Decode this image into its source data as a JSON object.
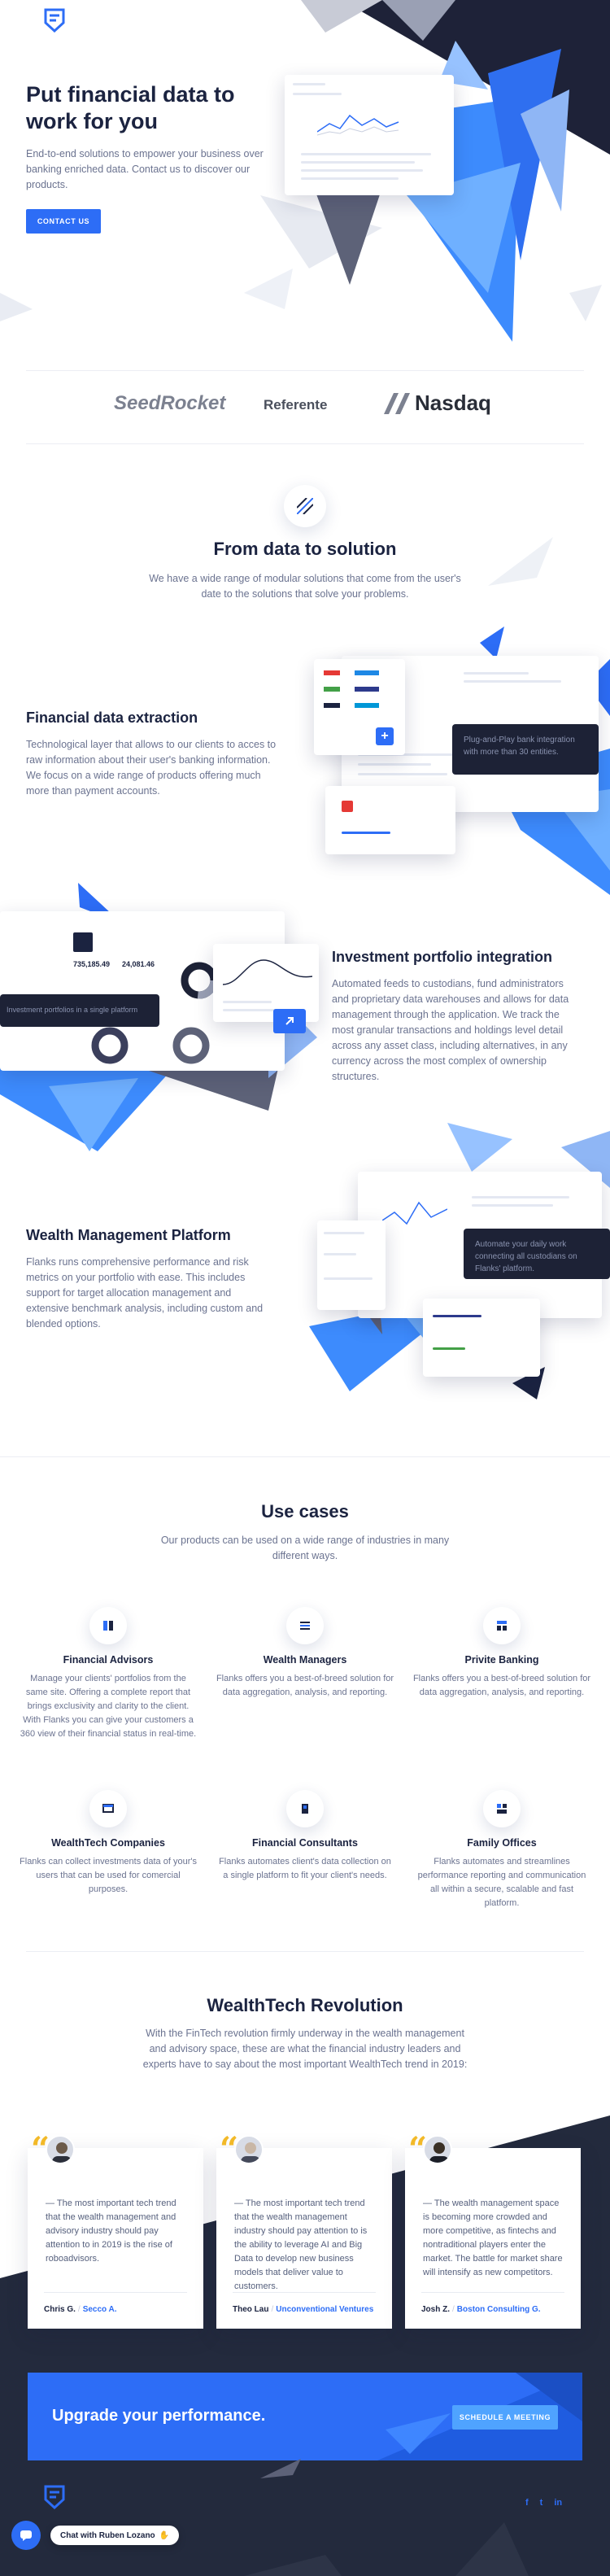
{
  "hero": {
    "title": "Put financial data to work for you",
    "subtitle": "End-to-end solutions to empower your business over banking enriched data. Contact us to discover our products.",
    "cta": "CONTACT US"
  },
  "partners": [
    "SeedRocket",
    "Referente",
    "Nasdaq"
  ],
  "solution": {
    "title": "From data to solution",
    "subtitle": "We have a wide range of modular solutions that come from the user's date to the solutions that solve your problems."
  },
  "features": [
    {
      "title": "Financial data extraction",
      "desc": "Technological layer that allows to our clients to acces to raw information about their user's banking information. We focus on a wide range of products offering much more than payment accounts.",
      "mock_note": "Plug-and-Play bank integration with more than 30 entities."
    },
    {
      "title": "Investment portfolio integration",
      "desc": "Automated feeds to custodians, fund administrators and proprietary data warehouses and allows for data management through the application. We track the most granular transactions and holdings level detail across any asset class, including alternatives, in any currency across the most complex of ownership structures.",
      "mock_note": "Investment portfolios in a single platform",
      "mock_values": [
        "735,185.49",
        "24,081.46"
      ]
    },
    {
      "title": "Wealth Management Platform",
      "desc": "Flanks runs comprehensive performance and risk metrics on your portfolio with ease. This includes support for target allocation management and extensive benchmark analysis, including custom and blended options.",
      "mock_note": "Automate your daily work connecting all custodians on Flanks' platform."
    }
  ],
  "use_cases": {
    "title": "Use cases",
    "subtitle": "Our products can be used on a wide range of industries in many different ways.",
    "items": [
      {
        "title": "Financial Advisors",
        "desc": "Manage your clients' portfolios from the same site. Offering a complete report that brings exclusivity and clarity to the client. With Flanks you can give your customers a 360 view of their financial status in real-time."
      },
      {
        "title": "Wealth Managers",
        "desc": "Flanks offers you a best-of-breed solution for data aggregation, analysis, and reporting."
      },
      {
        "title": "Privite Banking",
        "desc": "Flanks offers you a best-of-breed solution for data aggregation, analysis, and reporting."
      },
      {
        "title": "WealthTech Companies",
        "desc": "Flanks can collect investments data of your's users that can be used for comercial purposes."
      },
      {
        "title": "Financial Consultants",
        "desc": "Flanks automates client's data collection on a single platform to fit your client's needs."
      },
      {
        "title": "Family Offices",
        "desc": "Flanks automates and streamlines performance reporting and communication all within a secure, scalable and fast platform."
      }
    ]
  },
  "revolution": {
    "title": "WealthTech Revolution",
    "subtitle": "With the FinTech revolution firmly underway in the wealth management and advisory space, these are what the financial industry leaders and experts have to say about the most important WealthTech trend in 2019:",
    "testimonials": [
      {
        "quote": "— The most important tech trend that the wealth management and advisory industry should pay attention to in 2019 is the rise of roboadvisors.",
        "name": "Chris G.",
        "company": "Secco A."
      },
      {
        "quote": "— The most important tech trend that the wealth management industry should pay attention to is the ability to leverage AI and Big Data to develop new business models that deliver value to customers.",
        "name": "Theo Lau",
        "company": "Unconventional Ventures"
      },
      {
        "quote": "— The wealth management space is becoming more crowded and more competitive, as fintechs and nontraditional players enter the market. The battle for market share will intensify as new competitors.",
        "name": "Josh Z.",
        "company": "Boston Consulting G."
      }
    ]
  },
  "upgrade": {
    "title": "Upgrade your performance.",
    "cta": "SCHEDULE A MEETING"
  },
  "footer": {
    "social": [
      "f",
      "t",
      "in"
    ],
    "chat": "Chat with Ruben Lozano"
  },
  "colors": {
    "brand_blue": "#2d6df6",
    "navy": "#1b2340",
    "dark_footer": "#232a3d"
  }
}
